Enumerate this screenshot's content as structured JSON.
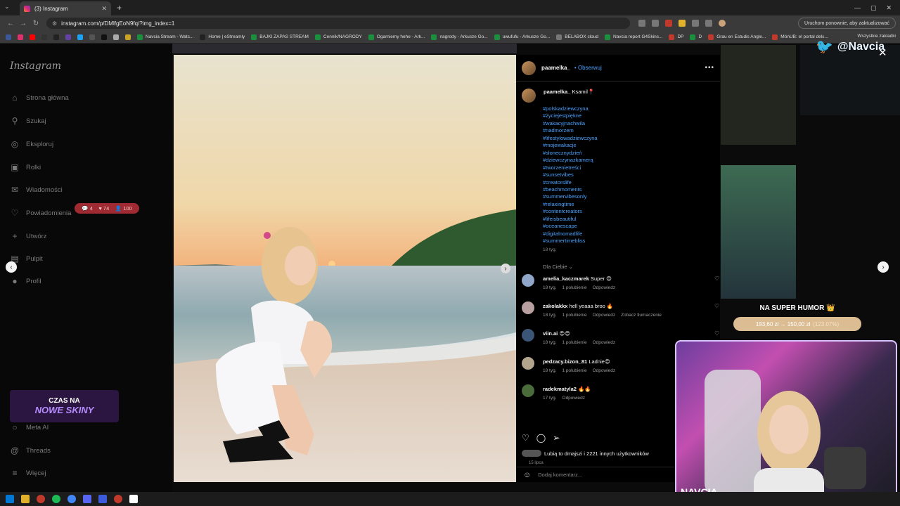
{
  "browser": {
    "tab_title": "(3) Instagram",
    "url": "instagram.com/p/DMlfgEoN9fq/?img_index=1",
    "relaunch_label": "Uruchom ponownie, aby zaktualizować",
    "bookmarks": [
      {
        "label": "Navcia Stream - Watc...",
        "color": "#1a8f3c"
      },
      {
        "label": "Home | eStreamly",
        "color": "#222"
      },
      {
        "label": "BAJKI ZAPAS STREAM",
        "color": "#1a8f3c"
      },
      {
        "label": "Cennik/NAGRODY",
        "color": "#1a8f3c"
      },
      {
        "label": "Ogarniemy hehe - Ark...",
        "color": "#1a8f3c"
      },
      {
        "label": "nagrody - Arkusze Go...",
        "color": "#1a8f3c"
      },
      {
        "label": "uwufufu - Arkusze Go...",
        "color": "#1a8f3c"
      },
      {
        "label": "BELABOX cloud",
        "color": "#777"
      },
      {
        "label": "Navcia report G4Skins...",
        "color": "#1a8f3c"
      },
      {
        "label": "DP",
        "color": "#c0392b"
      },
      {
        "label": "D",
        "color": "#1a8f3c"
      },
      {
        "label": "Grau en Estudis Angle...",
        "color": "#c0392b"
      },
      {
        "label": "MónUB: el portal dels...",
        "color": "#c0392b"
      }
    ],
    "bookmarks_right": "Wszystkie zakładki"
  },
  "sidebar": {
    "logo": "Instagram",
    "items": [
      {
        "label": "Strona główna",
        "icon": "home-icon",
        "glyph": "⌂"
      },
      {
        "label": "Szukaj",
        "icon": "search-icon",
        "glyph": "⚲"
      },
      {
        "label": "Eksploruj",
        "icon": "compass-icon",
        "glyph": "◎"
      },
      {
        "label": "Rolki",
        "icon": "reels-icon",
        "glyph": "▣"
      },
      {
        "label": "Wiadomości",
        "icon": "messenger-icon",
        "glyph": "✉"
      },
      {
        "label": "Powiadomienia",
        "icon": "heart-icon",
        "glyph": "♡"
      },
      {
        "label": "Utwórz",
        "icon": "plus-icon",
        "glyph": "+"
      },
      {
        "label": "Pulpit",
        "icon": "dashboard-icon",
        "glyph": "▤"
      },
      {
        "label": "Profil",
        "icon": "avatar-icon",
        "glyph": "●"
      }
    ],
    "notifications": {
      "comments": "4",
      "likes": "74",
      "follows": "100"
    },
    "bottom_items": [
      {
        "label": "Meta AI",
        "icon": "meta-ai-icon",
        "glyph": "○"
      },
      {
        "label": "Threads",
        "icon": "threads-icon",
        "glyph": "@"
      },
      {
        "label": "Więcej",
        "icon": "menu-icon",
        "glyph": "≡"
      }
    ]
  },
  "post": {
    "username": "paamelka_",
    "follow_label": "Obserwuj",
    "caption_user": "paamelka_",
    "caption_text": "Ksamil📍",
    "hashtags": [
      "#polskadziewczyna",
      "#życiejestpiękne",
      "#wakacyjnachwila",
      "#nadmorzem",
      "#lifestylowadziewczyna",
      "#mojewakacje",
      "#słonecznydzień",
      "#dziewczynazkamerą",
      "#tworzenietreści",
      "#sunsetvibes",
      "#creatorslife",
      "#beachmoments",
      "#summervibesonly",
      "#relaxingtime",
      "#contentcreators",
      "#lifeisbeautiful",
      "#oceanescape",
      "#digitalnomadlife",
      "#summertimebliss"
    ],
    "time": "18 tyg.",
    "for_you_label": "Dla Ciebie ⌄",
    "comments": [
      {
        "user": "amelia_kaczmarek",
        "text": "Super 😍",
        "time": "18 tyg.",
        "likes": "1 polubienie",
        "reply": "Odpowiedz",
        "extra": "",
        "avatar_color": "#8fa6c9"
      },
      {
        "user": "zakolakkx",
        "text": "hell yeaaa broo 🔥",
        "time": "18 tyg.",
        "likes": "1 polubienie",
        "reply": "Odpowiedz",
        "extra": "Zobacz tłumaczenie",
        "avatar_color": "#b9a0a0"
      },
      {
        "user": "viin.ai",
        "text": "😍😍",
        "time": "18 tyg.",
        "likes": "1 polubienie",
        "reply": "Odpowiedz",
        "extra": "",
        "avatar_color": "#3b5577"
      },
      {
        "user": "pedzacy.bizon_81",
        "text": "Ladnie😍",
        "time": "18 tyg.",
        "likes": "1 polubienie",
        "reply": "Odpowiedz",
        "extra": "",
        "avatar_color": "#b3a48e"
      },
      {
        "user": "radekmatyla2",
        "text": "🔥🔥",
        "time": "17 tyg.",
        "likes": "",
        "reply": "Odpowiedz",
        "extra": "",
        "avatar_color": "#4a6b3a"
      }
    ],
    "likes_text": "Lubią to dmajszi i 2221 innych użytkowników",
    "date": "15 lipca",
    "add_comment_placeholder": "Dodaj komentarz..."
  },
  "overlay": {
    "twitter_handle": "@Navcia",
    "promo_line1": "CZAS NA",
    "promo_line2": "NOWE SKINY",
    "super_humor": "NA SUPER HUMOR 👑",
    "price_now": "193,60 zł → 150,00 zł",
    "price_discount": "(123.07%)",
    "webcam_label": "NAVCIA"
  }
}
